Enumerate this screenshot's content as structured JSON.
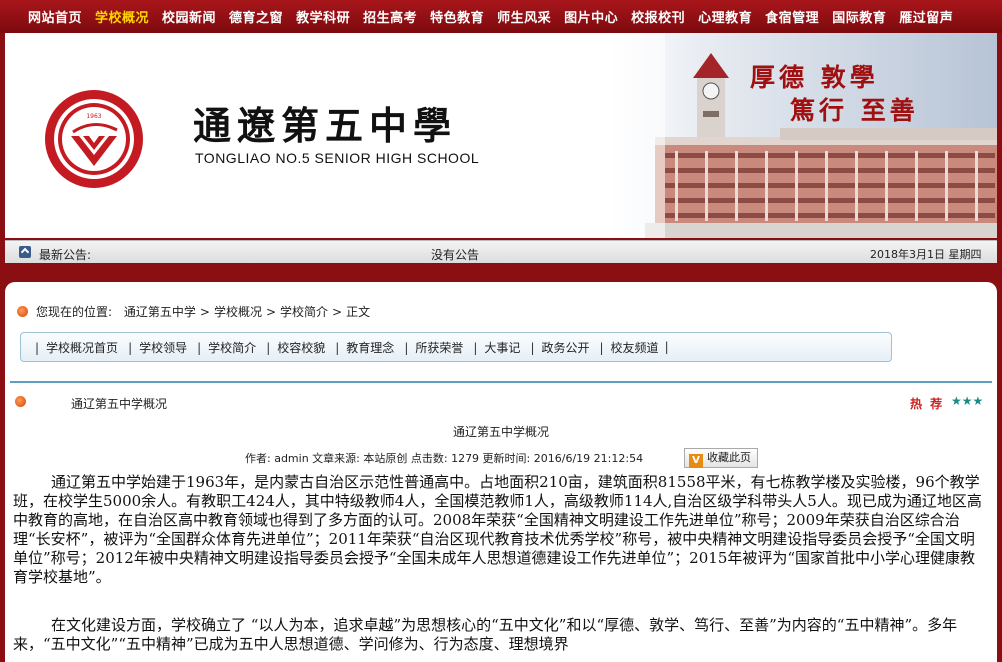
{
  "topnav": {
    "items": [
      "网站首页",
      "学校概况",
      "校园新闻",
      "德育之窗",
      "教学科研",
      "招生高考",
      "特色教育",
      "师生风采",
      "图片中心",
      "校报校刊",
      "心理教育",
      "食宿管理",
      "国际教育",
      "雁过留声"
    ],
    "active_index": 1
  },
  "banner": {
    "logo_year": "1963",
    "logo_ring": "TONGLIAO NO.5 SENIOR HIGH SCHOOL",
    "logo_bottom": "通遼第五中學",
    "school_name": "通遼第五中學",
    "school_name_en": "TONGLIAO NO.5 SENIOR  HIGH  SCHOOL",
    "motto_line1": "厚德 敦學",
    "motto_line2": "篤行 至善"
  },
  "notice": {
    "label": "最新公告:",
    "text": "没有公告",
    "date": "2018年3月1日 星期四"
  },
  "location": {
    "prefix": "您现在的位置:",
    "crumbs": [
      "通辽第五中学",
      "学校概况",
      "学校简介",
      "正文"
    ]
  },
  "subnav": {
    "items": [
      "学校概况首页",
      "学校领导",
      "学校简介",
      "校容校貌",
      "教育理念",
      "所获荣誉",
      "大事记",
      "政务公开",
      "校友频道"
    ]
  },
  "section": {
    "title": "通辽第五中学概况",
    "recommend_label": "热 荐",
    "stars": "★★★"
  },
  "article": {
    "title": "通辽第五中学概况",
    "meta": "作者: admin 文章来源: 本站原创 点击数: 1279 更新时间: 2016/6/19 21:12:54",
    "favorite_label": "收藏此页",
    "favorite_icon": "V",
    "para1": "通辽第五中学始建于1963年，是内蒙古自治区示范性普通高中。占地面积210亩，建筑面积81558平米，有七栋教学楼及实验楼，96个教学班，在校学生5000余人。有教职工424人，其中特级教师4人，全国模范教师1人，高级教师114人,自治区级学科带头人5人。现已成为通辽地区高中教育的高地，在自治区高中教育领域也得到了多方面的认可。2008年荣获“全国精神文明建设工作先进单位”称号；2009年荣获自治区综合治理“长安杯”，被评为“全国群众体育先进单位”；2011年荣获“自治区现代教育技术优秀学校”称号，被中央精神文明建设指导委员会授予“全国文明单位”称号；2012年被中央精神文明建设指导委员会授予“全国未成年人思想道德建设工作先进单位”；2015年被评为“国家首批中小学心理健康教育学校基地”。",
    "para2": "在文化建设方面，学校确立了 “以人为本，追求卓越”为思想核心的“五中文化”和以“厚德、敦学、笃行、至善”为内容的“五中精神”。多年来，“五中文化”“五中精神”已成为五中人思想道德、学问修为、行为态度、理想境界"
  },
  "colors": {
    "nav_red": "#8b0e12",
    "active_yellow": "#ffd400",
    "rule_blue": "#5b9fbe",
    "star_teal": "#1a8a8a"
  }
}
